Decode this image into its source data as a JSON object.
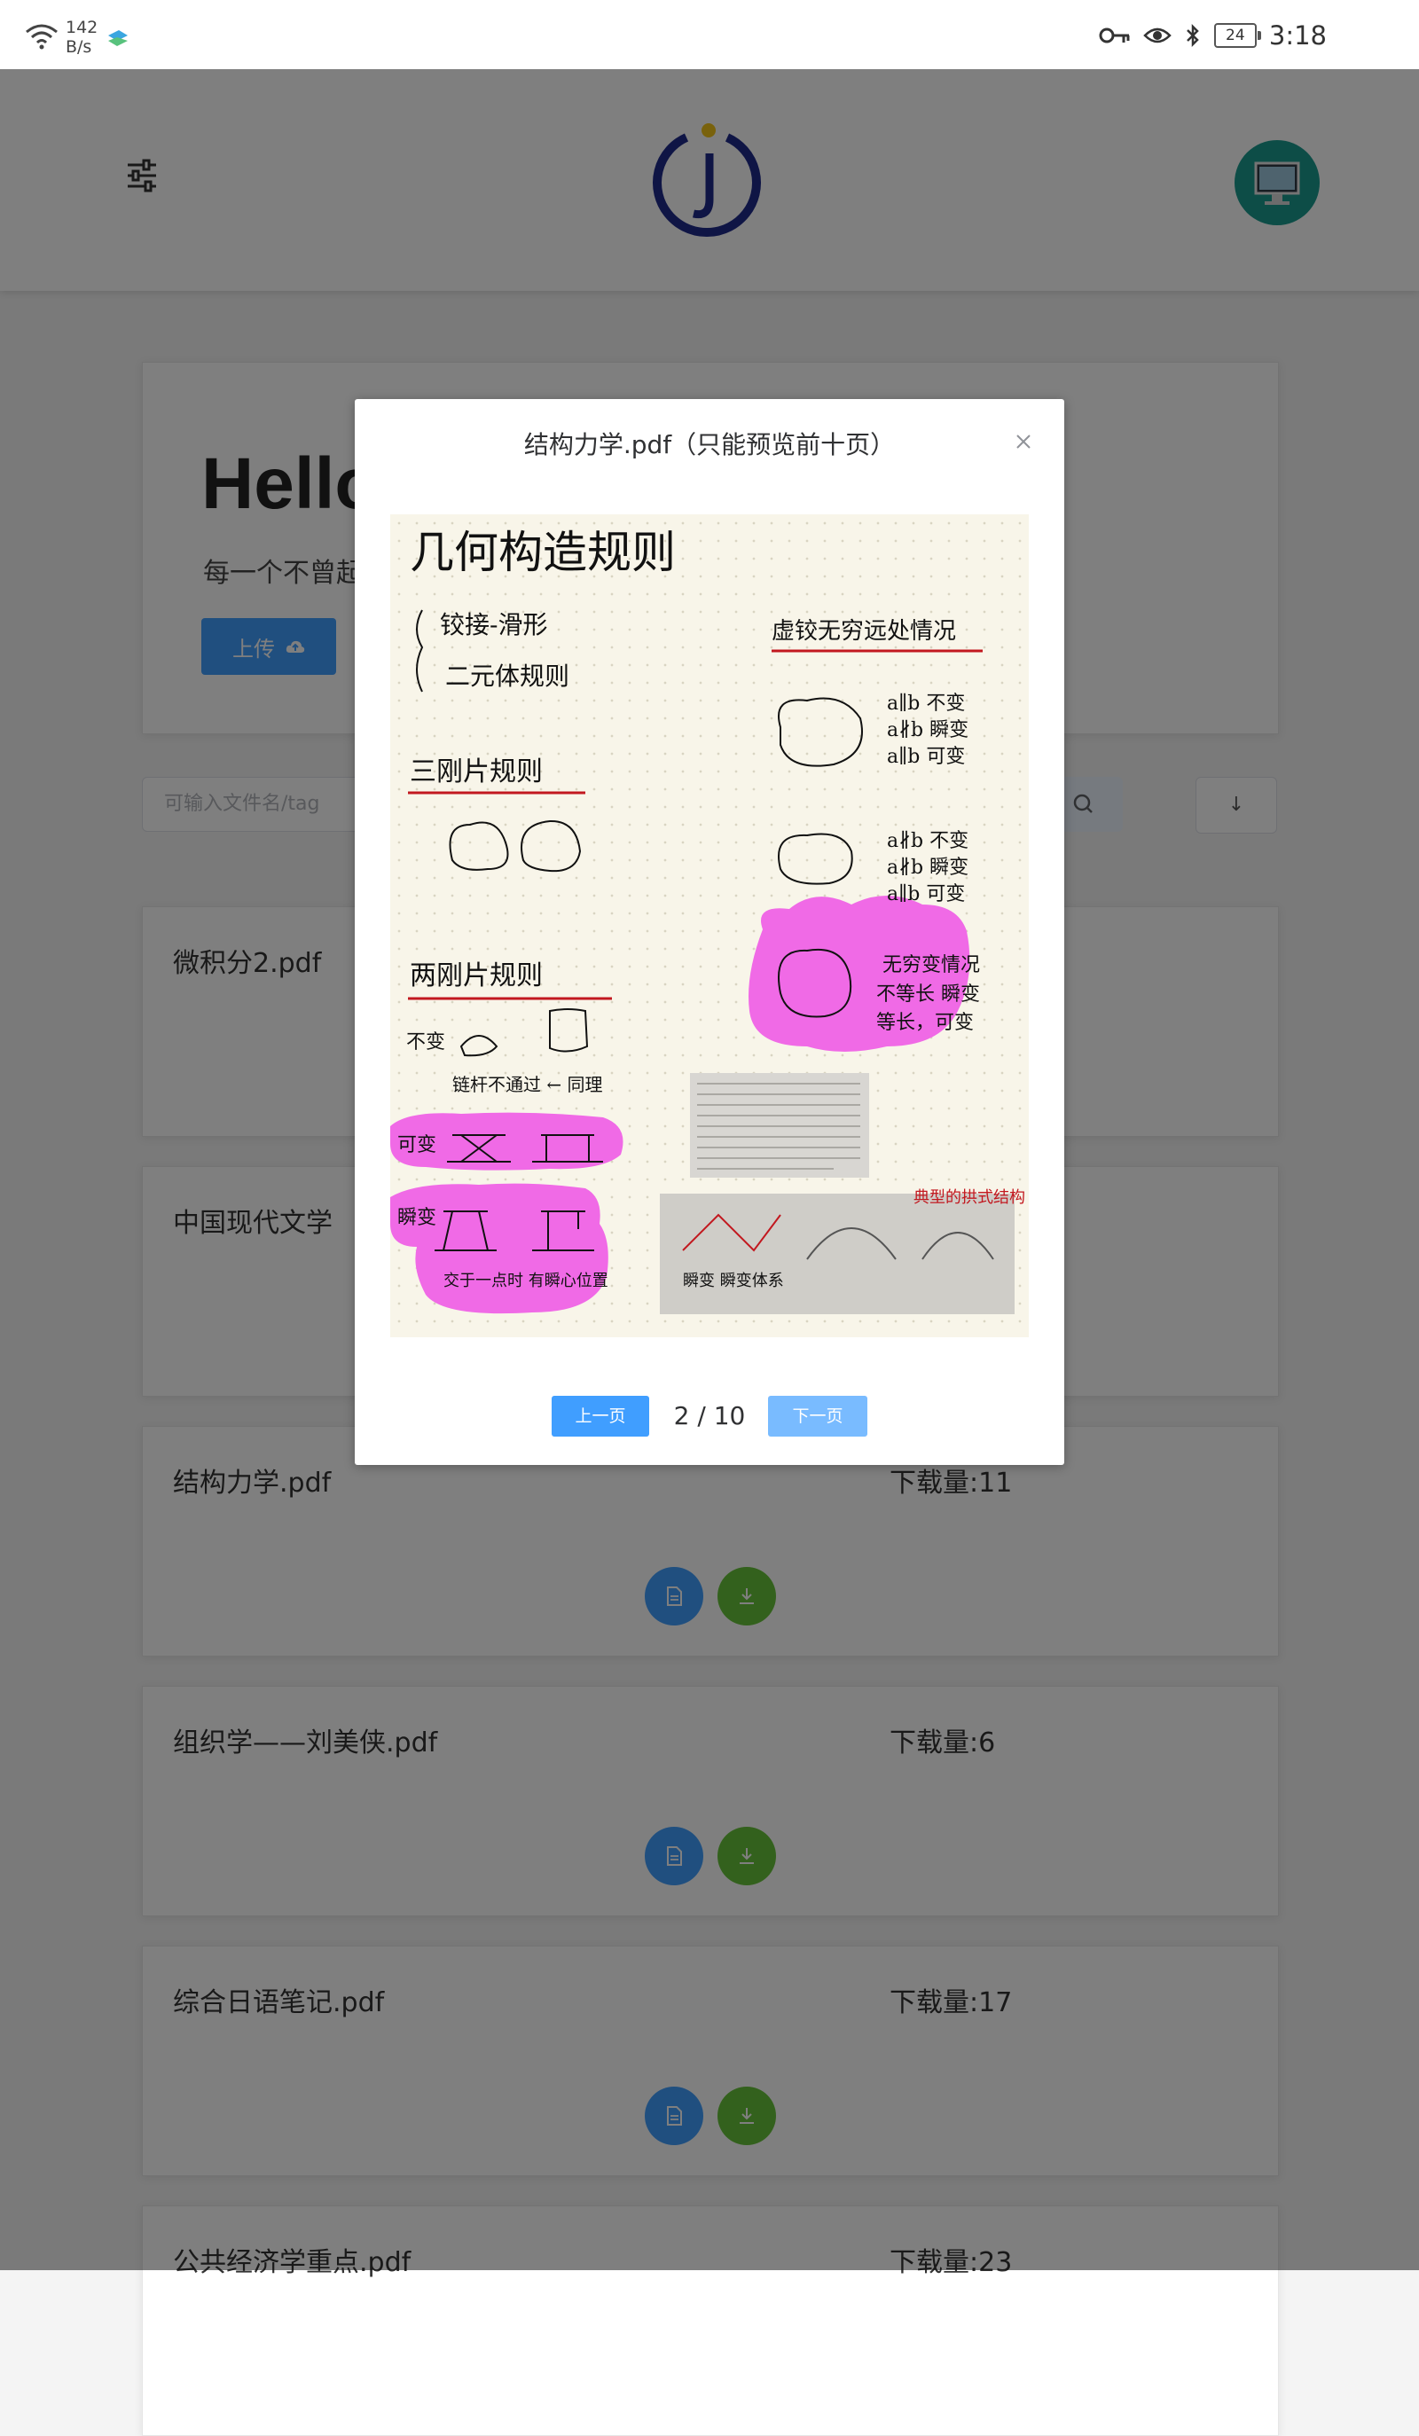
{
  "status_bar": {
    "net_speed_value": "142",
    "net_speed_unit": "B/s",
    "battery": "24",
    "time": "3:18"
  },
  "header": {
    "logo_letter": "J"
  },
  "hero": {
    "title": "Hello",
    "subtitle": "每一个不曾起",
    "upload_label": "上传"
  },
  "search": {
    "placeholder": "可输入文件名/tag",
    "sort_label": "↓"
  },
  "files": [
    {
      "name": "微积分2.pdf",
      "downloads": ""
    },
    {
      "name": "中国现代文学",
      "downloads": ""
    },
    {
      "name": "结构力学.pdf",
      "downloads": "下载量:11"
    },
    {
      "name": "组织学——刘美侠.pdf",
      "downloads": "下载量:6"
    },
    {
      "name": "综合日语笔记.pdf",
      "downloads": "下载量:17"
    },
    {
      "name": "公共经济学重点.pdf",
      "downloads": "下载量:23"
    }
  ],
  "modal": {
    "title": "结构力学.pdf（只能预览前十页）",
    "prev_label": "上一页",
    "next_label": "下一页",
    "page_indicator": "2 / 10",
    "page_content": {
      "heading": "几何构造规则",
      "left_notes": [
        "铰接-滑形",
        "二元体规则"
      ],
      "right_header": "虚铰无穷远处情况",
      "section1": "三刚片规则",
      "section2": "两刚片规则",
      "labels": [
        "可变",
        "瞬变",
        "不变",
        "瞬变",
        "可变"
      ]
    }
  },
  "colors": {
    "primary": "#409eff",
    "success": "#67c23a",
    "avatar": "#1a9a8e",
    "highlight": "#f06ae6"
  }
}
